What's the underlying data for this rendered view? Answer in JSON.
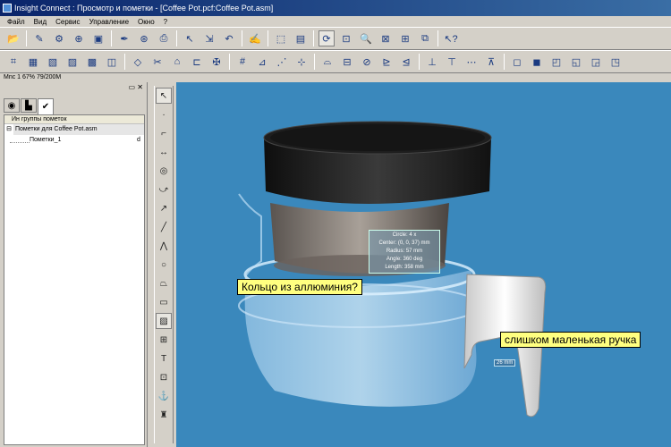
{
  "window": {
    "title": "Insight Connect : Просмотр и пометки - [Coffee Pot.pcf:Coffee Pot.asm]"
  },
  "menu": [
    "Файл",
    "Вид",
    "Сервис",
    "Управление",
    "Окно",
    "?"
  ],
  "status": {
    "text": "Mnc 1 67% 79/200M"
  },
  "panel": {
    "header": "Ин группы пометок",
    "tree": [
      {
        "label": "Пометки для Coffee Pot.asm",
        "expander": "⊟"
      },
      {
        "label": "Пометки_1",
        "flag": "d"
      }
    ]
  },
  "annotations": {
    "ring_note": "Кольцо из аллюминия?",
    "handle_note": "слишком маленькая ручка",
    "circle_info": [
      "Circle: 4 x",
      "Center: (0, 0, 37) mm",
      "Radius: 57 mm",
      "Angle: 360 deg",
      "Length: 358 mm"
    ],
    "dimension": "26 mm"
  },
  "colors": {
    "viewport_bg": "#3a88bc",
    "note_bg": "#ffff80",
    "lid": "#1a1a1a"
  }
}
